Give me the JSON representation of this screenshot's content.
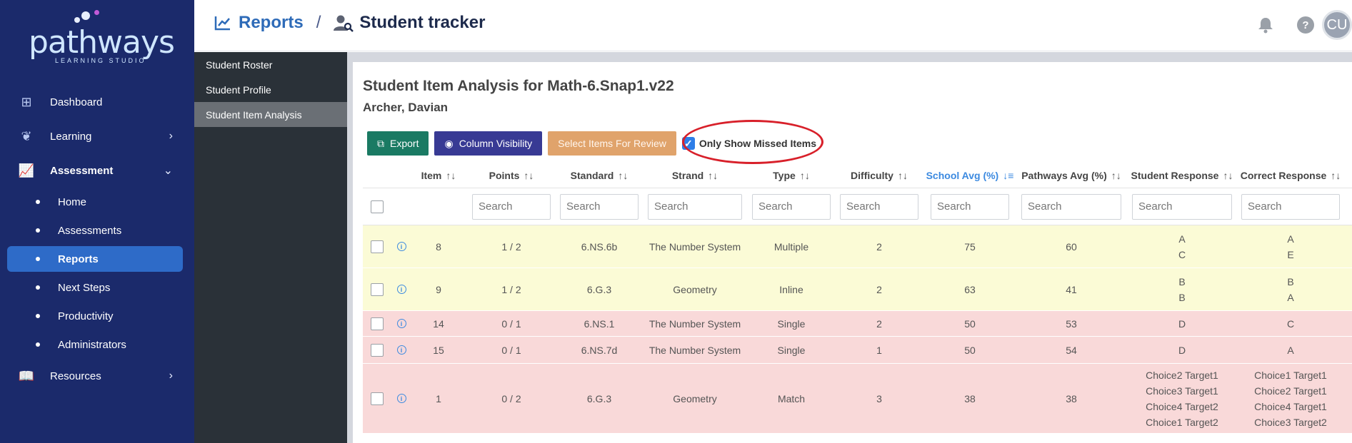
{
  "brand": {
    "name": "pathways",
    "tagline": "LEARNING STUDIO"
  },
  "nav": {
    "dashboard": "Dashboard",
    "learning": "Learning",
    "assessment": "Assessment",
    "sub": [
      "Home",
      "Assessments",
      "Reports",
      "Next Steps",
      "Productivity",
      "Administrators"
    ],
    "resources": "Resources"
  },
  "header": {
    "crumb1": "Reports",
    "separator": "/",
    "crumb2": "Student tracker",
    "avatar": "CU"
  },
  "subnav": [
    "Student Roster",
    "Student Profile",
    "Student Item Analysis"
  ],
  "page": {
    "title": "Student Item Analysis for Math-6.Snap1.v22",
    "student": "Archer, Davian"
  },
  "toolbar": {
    "export": "Export",
    "column_visibility": "Column Visibility",
    "select_items": "Select Items For Review",
    "only_missed": "Only Show Missed Items",
    "only_missed_checked": true
  },
  "table": {
    "columns": [
      "Item",
      "Points",
      "Standard",
      "Strand",
      "Type",
      "Difficulty",
      "School Avg (%)",
      "Pathways Avg (%)",
      "Student Response",
      "Correct Response"
    ],
    "sorted_column": "School Avg (%)",
    "search_placeholder": "Search",
    "rows": [
      {
        "status": "partial",
        "item": "8",
        "points": "1 / 2",
        "standard": "6.NS.6b",
        "strand": "The Number System",
        "type": "Multiple",
        "difficulty": "2",
        "school_avg": "75",
        "pathways_avg": "60",
        "student_response": [
          "A",
          "C"
        ],
        "correct_response": [
          "A",
          "E"
        ]
      },
      {
        "status": "partial",
        "item": "9",
        "points": "1 / 2",
        "standard": "6.G.3",
        "strand": "Geometry",
        "type": "Inline",
        "difficulty": "2",
        "school_avg": "63",
        "pathways_avg": "41",
        "student_response": [
          "B",
          "B"
        ],
        "correct_response": [
          "B",
          "A"
        ]
      },
      {
        "status": "incorrect",
        "item": "14",
        "points": "0 / 1",
        "standard": "6.NS.1",
        "strand": "The Number System",
        "type": "Single",
        "difficulty": "2",
        "school_avg": "50",
        "pathways_avg": "53",
        "student_response": [
          "D"
        ],
        "correct_response": [
          "C"
        ]
      },
      {
        "status": "incorrect",
        "item": "15",
        "points": "0 / 1",
        "standard": "6.NS.7d",
        "strand": "The Number System",
        "type": "Single",
        "difficulty": "1",
        "school_avg": "50",
        "pathways_avg": "54",
        "student_response": [
          "D"
        ],
        "correct_response": [
          "A"
        ]
      },
      {
        "status": "incorrect",
        "item": "1",
        "points": "0 / 2",
        "standard": "6.G.3",
        "strand": "Geometry",
        "type": "Match",
        "difficulty": "3",
        "school_avg": "38",
        "pathways_avg": "38",
        "student_response": [
          "Choice2 Target1",
          "Choice3 Target1",
          "Choice4 Target2",
          "Choice1 Target2"
        ],
        "correct_response": [
          "Choice1 Target1",
          "Choice2 Target1",
          "Choice4 Target1",
          "Choice3 Target2"
        ]
      }
    ]
  },
  "colors": {
    "nav_bg": "#1b2a6b",
    "active": "#2e6bc8",
    "partial_row": "#fbfbd6",
    "incorrect_row": "#f9d9d9",
    "highlight_oval": "#d8202a"
  }
}
